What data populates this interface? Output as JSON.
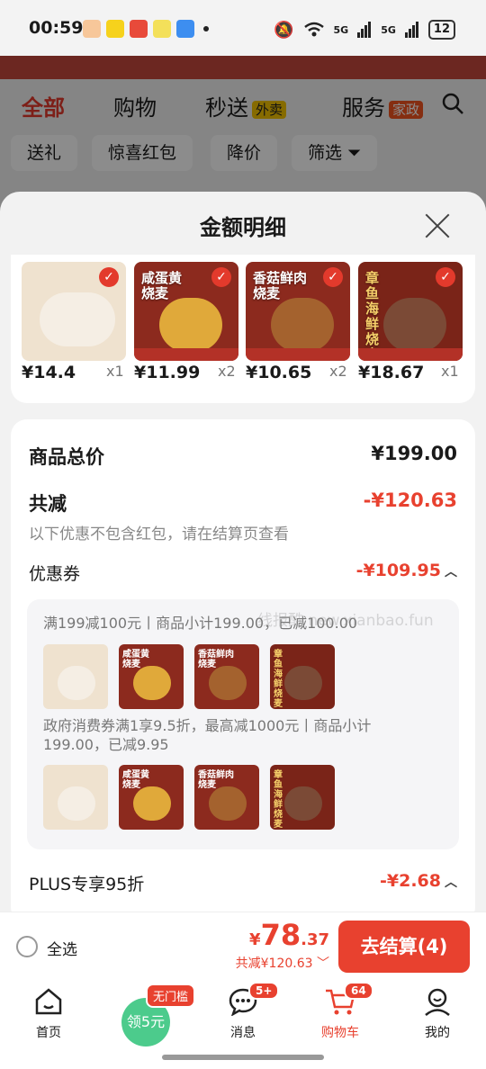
{
  "status": {
    "time": "00:59",
    "network1": "5G",
    "network2": "5G",
    "battery": "12"
  },
  "background": {
    "tabs": [
      {
        "label": "全部"
      },
      {
        "label": "购物"
      },
      {
        "label": "秒送",
        "badge": "外卖"
      },
      {
        "label": "服务",
        "badge": "家政"
      }
    ],
    "filters": [
      "送礼",
      "惊喜红包",
      "降价",
      "筛选"
    ]
  },
  "sheet": {
    "title": "金额明细",
    "products": [
      {
        "label": "",
        "price": "¥14.4",
        "qty": "x1"
      },
      {
        "label": "咸蛋黄 烧麦",
        "price": "¥11.99",
        "qty": "x2"
      },
      {
        "label": "香菇鲜肉 烧麦",
        "price": "¥10.65",
        "qty": "x2"
      },
      {
        "label": "章鱼海鲜烧麦",
        "price": "¥18.67",
        "qty": "x1"
      }
    ],
    "summary": {
      "total_label": "商品总价",
      "total_value": "¥199.00",
      "reduce_label": "共减",
      "reduce_value": "-¥120.63",
      "note": "以下优惠不包含红包，请在结算页查看",
      "coupon_label": "优惠券",
      "coupon_value": "-¥109.95",
      "coupon1": "满199减100元丨商品小计199.00，已减100.00",
      "coupon2_line1": "政府消费券满1享9.5折，最高减1000元丨商品小计",
      "coupon2_line2": "199.00，已减9.95",
      "thumb_labels": [
        "",
        "咸蛋黄 烧麦",
        "香菇鲜肉 烧麦",
        "章鱼海鲜烧麦"
      ],
      "plus_label": "PLUS专享95折",
      "plus_value": "-¥2.68"
    },
    "watermark": "线报酷 new.xianbao.fun"
  },
  "checkout": {
    "select_all": "全选",
    "price_symbol": "¥",
    "price_int": "78",
    "price_dec": ".37",
    "discount": "共减¥120.63",
    "button": "去结算(4)"
  },
  "tabbar": {
    "items": [
      {
        "label": "首页"
      },
      {
        "label": "领5元",
        "badge": "无门槛"
      },
      {
        "label": "消息",
        "badge": "5+"
      },
      {
        "label": "购物车",
        "badge": "64"
      },
      {
        "label": "我的"
      }
    ]
  },
  "colors": {
    "accent": "#e8412f",
    "sheet_bg": "#f2f2f2",
    "coupon_green": "#4ccb8c"
  }
}
